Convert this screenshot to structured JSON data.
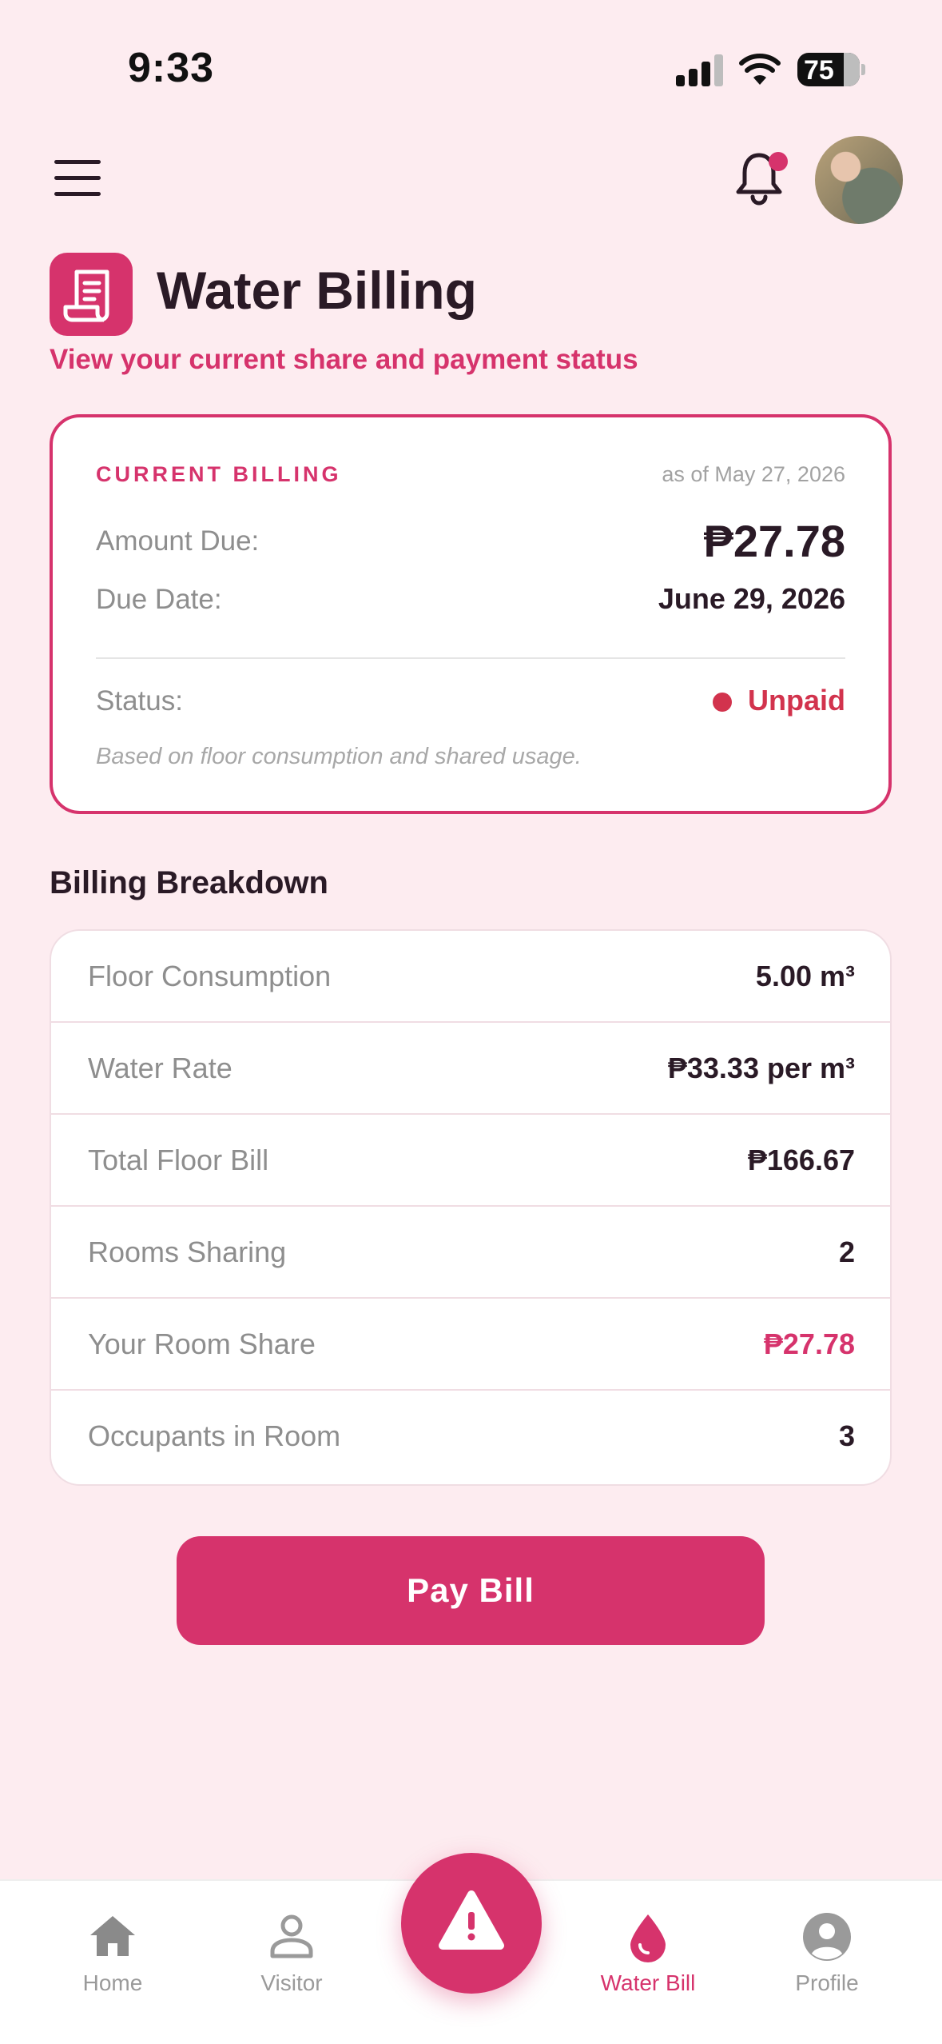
{
  "status_bar": {
    "time": "9:33",
    "battery": "75"
  },
  "header": {
    "title": "Water Billing",
    "subtitle": "View your current share and payment status"
  },
  "current_billing": {
    "label": "CURRENT BILLING",
    "as_of": "as of May 27, 2026",
    "amount_label": "Amount Due:",
    "amount": "₱27.78",
    "due_label": "Due Date:",
    "due_date": "June 29, 2026",
    "status_label": "Status:",
    "status": "Unpaid",
    "note": "Based on floor consumption and shared usage."
  },
  "breakdown": {
    "title": "Billing Breakdown",
    "rows": [
      {
        "label": "Floor Consumption",
        "value": "5.00 m³"
      },
      {
        "label": "Water Rate",
        "value": "₱33.33 per m³"
      },
      {
        "label": "Total Floor Bill",
        "value": "₱166.67"
      },
      {
        "label": "Rooms Sharing",
        "value": "2"
      },
      {
        "label": "Your Room Share",
        "value": "₱27.78"
      },
      {
        "label": "Occupants in Room",
        "value": "3"
      }
    ]
  },
  "pay_button": "Pay Bill",
  "nav": {
    "items": [
      {
        "label": "Home",
        "icon": "home-icon"
      },
      {
        "label": "Visitor",
        "icon": "visitor-icon"
      },
      {
        "label": "Water Bill",
        "icon": "water-drop-icon",
        "active": true
      },
      {
        "label": "Profile",
        "icon": "profile-icon"
      }
    ],
    "fab_icon": "alert-triangle-icon"
  },
  "colors": {
    "accent": "#d6336c",
    "background": "#fdecf0",
    "unpaid": "#d2334d"
  }
}
